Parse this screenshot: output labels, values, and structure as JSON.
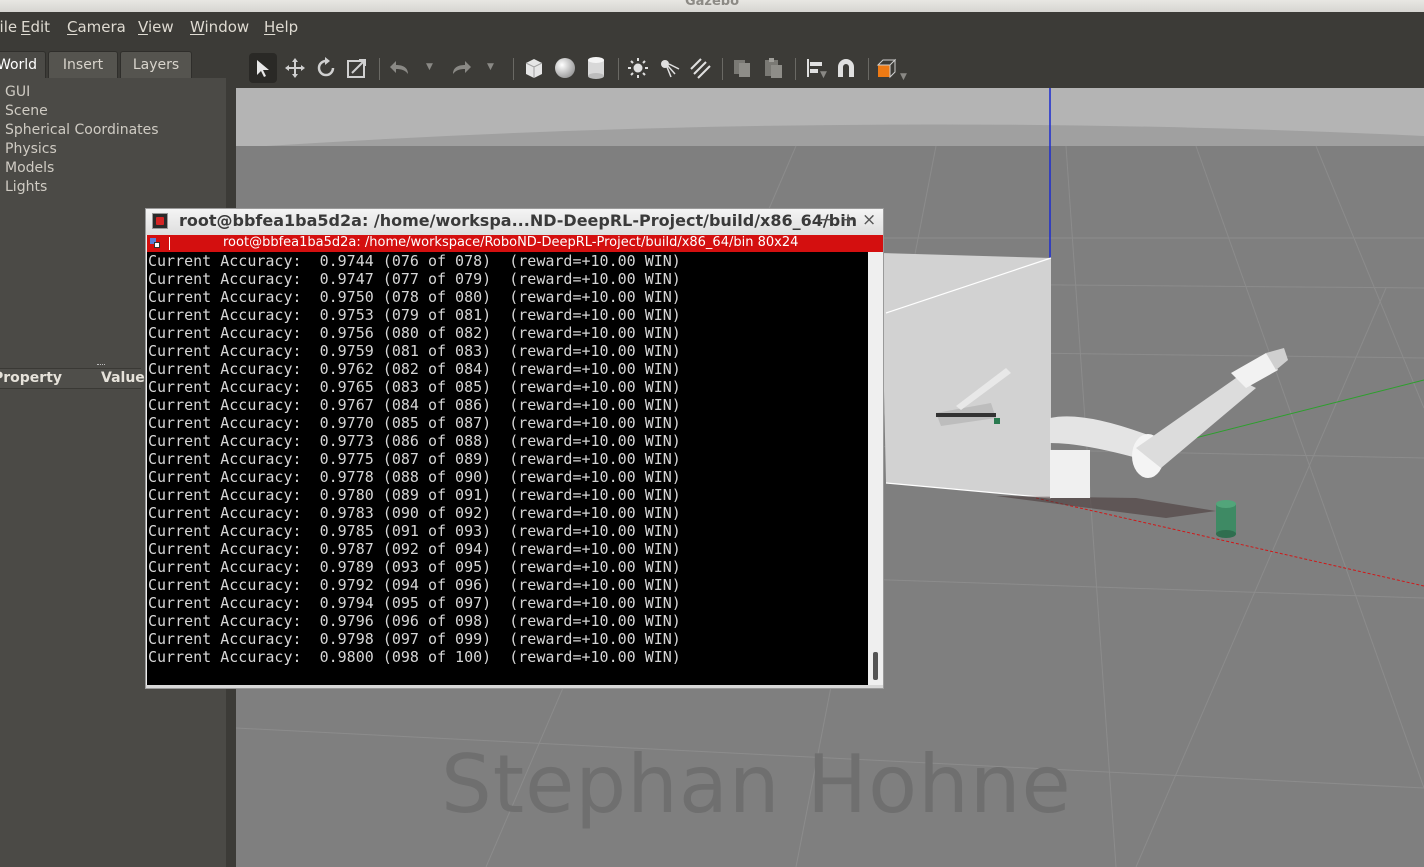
{
  "window": {
    "title": "Gazebo"
  },
  "menubar": {
    "items": [
      {
        "label": "File",
        "mnemonic": "F",
        "rest": "ile"
      },
      {
        "label": "Edit",
        "mnemonic": "E",
        "rest": "dit"
      },
      {
        "label": "Camera",
        "mnemonic": "C",
        "rest": "amera"
      },
      {
        "label": "View",
        "mnemonic": "V",
        "rest": "iew"
      },
      {
        "label": "Window",
        "mnemonic": "W",
        "rest": "indow"
      },
      {
        "label": "Help",
        "mnemonic": "H",
        "rest": "elp"
      }
    ]
  },
  "left_panel": {
    "tabs": [
      "World",
      "Insert",
      "Layers"
    ],
    "active_tab": "World",
    "tree_items": [
      "GUI",
      "Scene",
      "Spherical Coordinates",
      "Physics",
      "Models",
      "Lights"
    ],
    "property_header": {
      "property": "Property",
      "value": "Value"
    }
  },
  "toolbar": {
    "tools": [
      "select-tool",
      "translate-tool",
      "rotate-tool",
      "scale-tool",
      "undo",
      "redo",
      "box-shape",
      "sphere-shape",
      "cylinder-shape",
      "point-light",
      "spot-light",
      "directional-light",
      "copy",
      "paste",
      "align",
      "snap",
      "view-angle"
    ],
    "active_tool": "select-tool"
  },
  "viewport": {
    "watermark": "Stephan Hohne",
    "colors": {
      "background": "#7f7f7f",
      "grid": "#8c8c8c",
      "x_axis": "#d01818",
      "y_axis": "#2ca02c",
      "z_axis": "#1a2ad0"
    }
  },
  "terminal": {
    "title": "root@bbfea1ba5d2a: /home/workspa...ND-DeepRL-Project/build/x86_64/bin",
    "session_bar": "root@bbfea1ba5d2a: /home/workspace/RoboND-DeepRL-Project/build/x86_64/bin 80x24",
    "controls": {
      "minimize": "−",
      "maximize": "+",
      "close": "×"
    },
    "lines": [
      "Current Accuracy:  0.9744 (076 of 078)  (reward=+10.00 WIN)",
      "Current Accuracy:  0.9747 (077 of 079)  (reward=+10.00 WIN)",
      "Current Accuracy:  0.9750 (078 of 080)  (reward=+10.00 WIN)",
      "Current Accuracy:  0.9753 (079 of 081)  (reward=+10.00 WIN)",
      "Current Accuracy:  0.9756 (080 of 082)  (reward=+10.00 WIN)",
      "Current Accuracy:  0.9759 (081 of 083)  (reward=+10.00 WIN)",
      "Current Accuracy:  0.9762 (082 of 084)  (reward=+10.00 WIN)",
      "Current Accuracy:  0.9765 (083 of 085)  (reward=+10.00 WIN)",
      "Current Accuracy:  0.9767 (084 of 086)  (reward=+10.00 WIN)",
      "Current Accuracy:  0.9770 (085 of 087)  (reward=+10.00 WIN)",
      "Current Accuracy:  0.9773 (086 of 088)  (reward=+10.00 WIN)",
      "Current Accuracy:  0.9775 (087 of 089)  (reward=+10.00 WIN)",
      "Current Accuracy:  0.9778 (088 of 090)  (reward=+10.00 WIN)",
      "Current Accuracy:  0.9780 (089 of 091)  (reward=+10.00 WIN)",
      "Current Accuracy:  0.9783 (090 of 092)  (reward=+10.00 WIN)",
      "Current Accuracy:  0.9785 (091 of 093)  (reward=+10.00 WIN)",
      "Current Accuracy:  0.9787 (092 of 094)  (reward=+10.00 WIN)",
      "Current Accuracy:  0.9789 (093 of 095)  (reward=+10.00 WIN)",
      "Current Accuracy:  0.9792 (094 of 096)  (reward=+10.00 WIN)",
      "Current Accuracy:  0.9794 (095 of 097)  (reward=+10.00 WIN)",
      "Current Accuracy:  0.9796 (096 of 098)  (reward=+10.00 WIN)",
      "Current Accuracy:  0.9798 (097 of 099)  (reward=+10.00 WIN)",
      "Current Accuracy:  0.9800 (098 of 100)  (reward=+10.00 WIN)"
    ]
  }
}
